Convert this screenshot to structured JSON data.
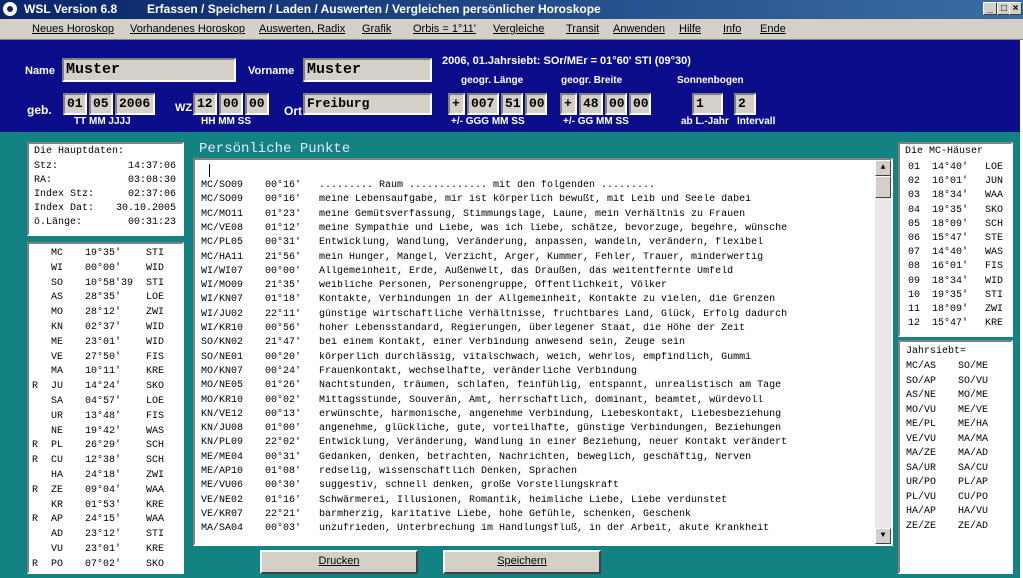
{
  "window": {
    "app": "WSL Version 6.8",
    "subtitle": "Erfassen / Speichern / Laden / Auswerten / Vergleichen persönlicher Horoskope",
    "controls": [
      "_",
      "□",
      "×"
    ]
  },
  "menu": [
    "Neues Horoskop",
    "Vorhandenes Horoskop",
    "Auswerten, Radix",
    "Grafik",
    "Orbis = 1°11'",
    "Vergleiche",
    "Transit",
    "Anwenden",
    "Hilfe",
    "Info",
    "Ende"
  ],
  "header": {
    "name_label": "Name",
    "name_value": "Muster",
    "vorname_label": "Vorname",
    "vorname_value": "Muster",
    "jahrsiebt_info": "2006, 01.Jahrsiebt: SOr/MEr = 01°60' STI (09°30)",
    "geb_label": "geb.",
    "geb_day": "01",
    "geb_month": "05",
    "geb_year": "2006",
    "date_hint": "TT  MM   JJJJ",
    "wz_label": "WZ",
    "wz_h": "12",
    "wz_m": "00",
    "wz_s": "00",
    "time_hint": "HH  MM  SS",
    "ort_label": "Ort",
    "ort_value": "Freiburg",
    "laenge_label": "geogr. Länge",
    "laenge_sign": "+",
    "laenge_g": "007",
    "laenge_m": "51",
    "laenge_s": "00",
    "laenge_hint": "+/-   GGG  MM  SS",
    "breite_label": "geogr. Breite",
    "breite_sign": "+",
    "breite_g": "48",
    "breite_m": "00",
    "breite_s": "00",
    "breite_hint": "+/-   GG  MM  SS",
    "sonnenbogen_label": "Sonnenbogen",
    "sb_jahr": "1",
    "sb_intervall": "2",
    "sb_hint_jahr": "ab L.-Jahr",
    "sb_hint_int": "Intervall"
  },
  "hauptdaten": {
    "title": "Die Hauptdaten:",
    "rows": [
      [
        "Stz:",
        "14:37:06"
      ],
      [
        "RA:",
        "03:08:30"
      ],
      [
        "Index Stz:",
        "02:37:06"
      ],
      [
        "Index Dat:",
        "30.10.2005"
      ],
      [
        "ö.Länge:",
        "00:31:23"
      ]
    ]
  },
  "planets": [
    [
      "",
      "MC",
      "19°35'",
      "STI"
    ],
    [
      "",
      "WI",
      "00°00'",
      "WID"
    ],
    [
      "",
      "SO",
      "10°58'39",
      "STI"
    ],
    [
      "",
      "AS",
      "28°35'",
      "LOE"
    ],
    [
      "",
      "MO",
      "28°12'",
      "ZWI"
    ],
    [
      "",
      "KN",
      "02°37'",
      "WID"
    ],
    [
      "",
      "ME",
      "23°01'",
      "WID"
    ],
    [
      "",
      "VE",
      "27°50'",
      "FIS"
    ],
    [
      "",
      "MA",
      "10°11'",
      "KRE"
    ],
    [
      "R",
      "JU",
      "14°24'",
      "SKO"
    ],
    [
      "",
      "SA",
      "04°57'",
      "LOE"
    ],
    [
      "",
      "UR",
      "13°48'",
      "FIS"
    ],
    [
      "",
      "NE",
      "19°42'",
      "WAS"
    ],
    [
      "R",
      "PL",
      "26°29'",
      "SCH"
    ],
    [
      "R",
      "CU",
      "12°38'",
      "SCH"
    ],
    [
      "",
      "HA",
      "24°18'",
      "ZWI"
    ],
    [
      "R",
      "ZE",
      "09°04'",
      "WAA"
    ],
    [
      "",
      "KR",
      "01°53'",
      "KRE"
    ],
    [
      "R",
      "AP",
      "24°15'",
      "WAA"
    ],
    [
      "",
      "AD",
      "23°12'",
      "STI"
    ],
    [
      "",
      "VU",
      "23°01'",
      "KRE"
    ],
    [
      "R",
      "PO",
      "07°02'",
      "SKO"
    ]
  ],
  "persoenlich": {
    "title": "Persönliche Punkte",
    "rows": [
      [
        "MC/SO09",
        "00°16'",
        "......... Raum ............. mit den folgenden ........."
      ],
      [
        "MC/SO09",
        "00°16'",
        "meine Lebensaufgabe, mir ist körperlich bewußt, mit Leib und Seele dabei"
      ],
      [
        "MC/MO11",
        "01°23'",
        "meine Gemütsverfassung, Stimmungslage, Laune, mein Verhältnis zu Frauen"
      ],
      [
        "MC/VE08",
        "01°12'",
        "meine Sympathie und Liebe, was ich liebe, schätze, bevorzuge, begehre, wünsche"
      ],
      [
        "MC/PL05",
        "00°31'",
        "Entwicklung, Wandlung, Veränderung, anpassen, wandeln, verändern, flexibel"
      ],
      [
        "MC/HA11",
        "21°56'",
        "mein Hunger, Mangel, Verzicht, Ärger, Kummer, Fehler, Trauer, minderwertig"
      ],
      [
        "WI/WI07",
        "00°00'",
        "Allgemeinheit, Erde, Außenwelt, das Draußen, das weitentfernte Umfeld"
      ],
      [
        "WI/MO09",
        "21°35'",
        "weibliche Personen, Personengruppe, Öffentlichkeit, Völker"
      ],
      [
        "WI/KN07",
        "01°18'",
        "Kontakte, Verbindungen in der Allgemeinheit, Kontakte zu vielen, die Grenzen"
      ],
      [
        "WI/JU02",
        "22°11'",
        "günstige wirtschaftliche Verhältnisse, fruchtbares Land, Glück, Erfolg dadurch"
      ],
      [
        "WI/KR10",
        "00°56'",
        "hoher Lebensstandard, Regierungen, überlegener Staat, die Höhe der Zeit"
      ],
      [
        "SO/KN02",
        "21°47'",
        "bei einem Kontakt, einer Verbindung anwesend sein, Zeuge sein"
      ],
      [
        "SO/NE01",
        "00°20'",
        "körperlich durchlässig, vitalschwach, weich, wehrlos, empfindlich, Gummi"
      ],
      [
        "MO/KN07",
        "00°24'",
        "Frauenkontakt, wechselhafte, veränderliche Verbindung"
      ],
      [
        "MO/NE05",
        "01°26'",
        "Nachtstunden, träumen, schlafen, feinfühlig, entspannt, unrealistisch am Tage"
      ],
      [
        "MO/KR10",
        "00°02'",
        "Mittagsstunde, Souverän, Amt, herrschaftlich, dominant, beamtet, würdevoll"
      ],
      [
        "KN/VE12",
        "00°13'",
        "erwünschte, harmonische, angenehme Verbindung, Liebeskontakt, Liebesbeziehung"
      ],
      [
        "KN/JU08",
        "01°00'",
        "angenehme, glückliche, gute, vorteilhafte, günstige Verbindungen, Beziehungen"
      ],
      [
        "KN/PL09",
        "22°02'",
        "Entwicklung, Veränderung, Wandlung in einer Beziehung, neuer Kontakt verändert"
      ],
      [
        "ME/ME04",
        "00°31'",
        "Gedanken, denken, betrachten, Nachrichten, beweglich, geschäftig, Nerven"
      ],
      [
        "ME/AP10",
        "01°08'",
        "redselig, wissenschaftlich Denken, Sprachen"
      ],
      [
        "ME/VU06",
        "00°30'",
        "suggestiv, schnell denken, große Vorstellungskraft"
      ],
      [
        "VE/NE02",
        "01°16'",
        "Schwärmerei, Illusionen, Romantik, heimliche Liebe, Liebe verdunstet"
      ],
      [
        "VE/KR07",
        "22°21'",
        "barmherzig, karitative Liebe, hohe Gefühle, schenken, Geschenk"
      ],
      [
        "MA/SA04",
        "00°03'",
        "unzufrieden, Unterbrechung im Handlungsfluß, in der Arbeit, akute Krankheit"
      ]
    ]
  },
  "mc_haeuser": {
    "title": "Die MC-Häuser",
    "rows": [
      [
        "01",
        "14°40'",
        "LOE"
      ],
      [
        "02",
        "16°01'",
        "JUN"
      ],
      [
        "03",
        "18°34'",
        "WAA"
      ],
      [
        "04",
        "19°35'",
        "SKO"
      ],
      [
        "05",
        "18°09'",
        "SCH"
      ],
      [
        "06",
        "15°47'",
        "STE"
      ],
      [
        "07",
        "14°40'",
        "WAS"
      ],
      [
        "08",
        "16°01'",
        "FIS"
      ],
      [
        "09",
        "18°34'",
        "WID"
      ],
      [
        "10",
        "19°35'",
        "STI"
      ],
      [
        "11",
        "18°09'",
        "ZWI"
      ],
      [
        "12",
        "15°47'",
        "KRE"
      ]
    ]
  },
  "jahrsiebt": {
    "title": "Jahrsiebt=",
    "rows": [
      [
        "MC/AS",
        "SO/ME"
      ],
      [
        "SO/AP",
        "SO/VU"
      ],
      [
        "AS/NE",
        "MO/ME"
      ],
      [
        "MO/VU",
        "ME/VE"
      ],
      [
        "ME/PL",
        "ME/HA"
      ],
      [
        "VE/VU",
        "MA/MA"
      ],
      [
        "MA/ZE",
        "MA/AD"
      ],
      [
        "SA/UR",
        "SA/CU"
      ],
      [
        "UR/PO",
        "PL/AP"
      ],
      [
        "PL/VU",
        "CU/PO"
      ],
      [
        "HA/AP",
        "HA/VU"
      ],
      [
        "ZE/ZE",
        "ZE/AD"
      ]
    ]
  },
  "buttons": {
    "drucken": "Drucken",
    "speichern": "Speichern"
  },
  "colors": {
    "header_bg": "#0c0d8a",
    "main_bg": "#128282",
    "title_text": "#e8e8ff"
  }
}
